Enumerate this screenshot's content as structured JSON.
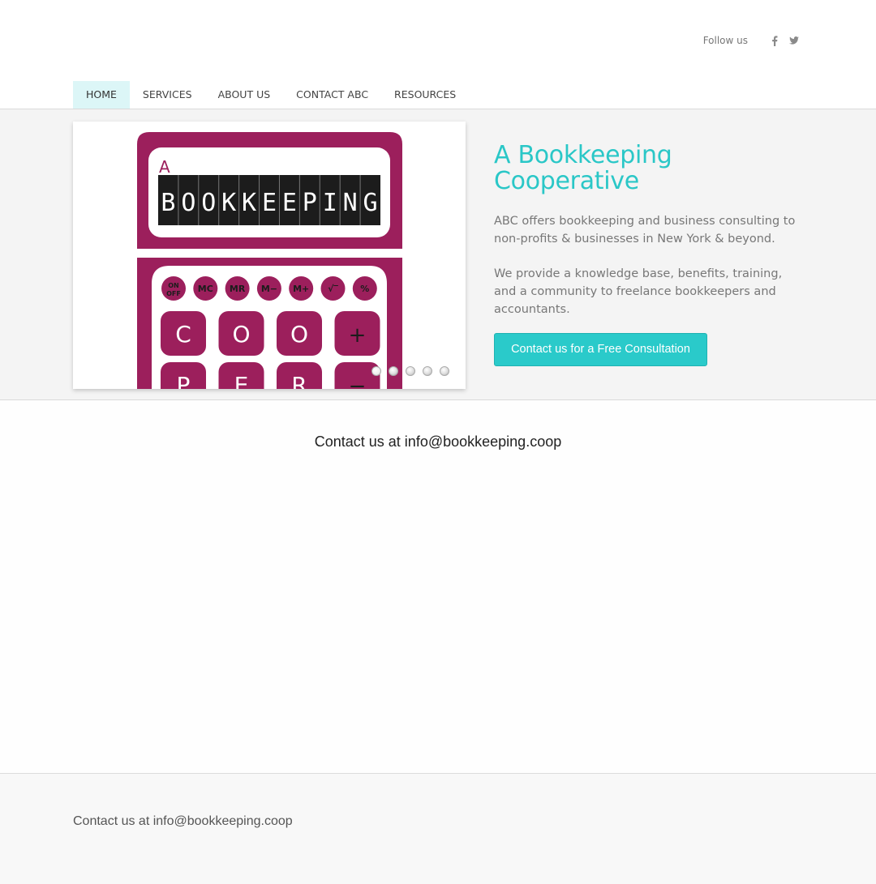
{
  "header": {
    "follow_label": "Follow us",
    "social_icons": [
      "facebook-icon",
      "twitter-icon"
    ]
  },
  "nav": {
    "items": [
      "HOME",
      "SERVICES",
      "ABOUT US",
      "CONTACT ABC",
      "RESOURCES"
    ],
    "active": "HOME"
  },
  "hero": {
    "slide": {
      "small_letter": "A",
      "display_text": "BOOKKEEPING",
      "func_keys": [
        "ON OFF",
        "MC",
        "MR",
        "M−",
        "M+",
        "√‾",
        "%"
      ],
      "row1_keys": [
        "C",
        "O",
        "O",
        "+"
      ],
      "row2_keys": [
        "P",
        "E",
        "R",
        "−"
      ]
    },
    "slide_count": 5,
    "active_slide": 1,
    "title": "A Bookkeeping Cooperative",
    "paragraph1": "ABC offers bookkeeping and business consulting to non-profits & businesses in New York & beyond.",
    "paragraph2": "We provide a knowledge base, benefits, training, and a community to freelance bookkeepers and accountants.",
    "cta_label": "Contact us for a Free Consultation"
  },
  "main": {
    "contact_text": "Contact us at info@bookkeeping.coop"
  },
  "footer": {
    "contact_text": "Contact us at info@bookkeeping.coop"
  },
  "colors": {
    "accent": "#2acaca",
    "nav_active_bg": "#dcf6f7",
    "calculator": "#9c1f5c"
  }
}
